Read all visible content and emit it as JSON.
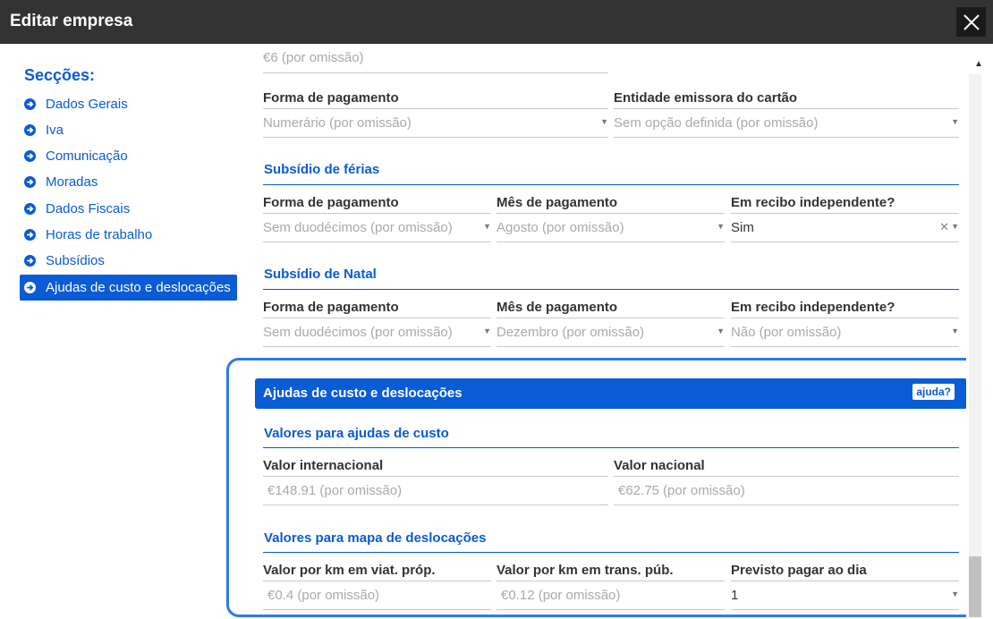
{
  "window": {
    "title": "Editar empresa"
  },
  "sidebar": {
    "heading": "Secções:",
    "items": [
      {
        "label": "Dados Gerais"
      },
      {
        "label": "Iva"
      },
      {
        "label": "Comunicação"
      },
      {
        "label": "Moradas"
      },
      {
        "label": "Dados Fiscais"
      },
      {
        "label": "Horas de trabalho"
      },
      {
        "label": "Subsídios"
      },
      {
        "label": "Ajudas de custo e deslocações",
        "active": true
      }
    ]
  },
  "subsidio_refeicao": {
    "top_value": "€6 (por omissão)"
  },
  "refeicao_payment": {
    "forma_label": "Forma de pagamento",
    "forma_value": "Numerário (por omissão)",
    "entidade_label": "Entidade emissora do cartão",
    "entidade_value": "Sem opção definida (por omissão)"
  },
  "ferias": {
    "title": "Subsídio de férias",
    "forma_label": "Forma de pagamento",
    "forma_value": "Sem duodécimos (por omissão)",
    "mes_label": "Mês de pagamento",
    "mes_value": "Agosto (por omissão)",
    "recibo_label": "Em recibo independente?",
    "recibo_value": "Sim"
  },
  "natal": {
    "title": "Subsídio de Natal",
    "forma_label": "Forma de pagamento",
    "forma_value": "Sem duodécimos (por omissão)",
    "mes_label": "Mês de pagamento",
    "mes_value": "Dezembro (por omissão)",
    "recibo_label": "Em recibo independente?",
    "recibo_value": "Não (por omissão)"
  },
  "ajudas": {
    "section_title": "Ajudas de custo e deslocações",
    "help_label": "ajuda?",
    "custo_title": "Valores para ajudas de custo",
    "internacional_label": "Valor internacional",
    "internacional_value": "€148.91 (por omissão)",
    "nacional_label": "Valor nacional",
    "nacional_value": "€62.75 (por omissão)",
    "mapa_title": "Valores para mapa de deslocações",
    "km_proprio_label": "Valor por km em viat. próp.",
    "km_proprio_value": "€0.4 (por omissão)",
    "km_publico_label": "Valor por km em trans. púb.",
    "km_publico_value": "€0.12 (por omissão)",
    "previsto_label": "Previsto pagar ao dia",
    "previsto_value": "1"
  },
  "colors": {
    "accent": "#0a5bd6",
    "titlebar": "#333333",
    "highlight": "#2d7be5"
  }
}
